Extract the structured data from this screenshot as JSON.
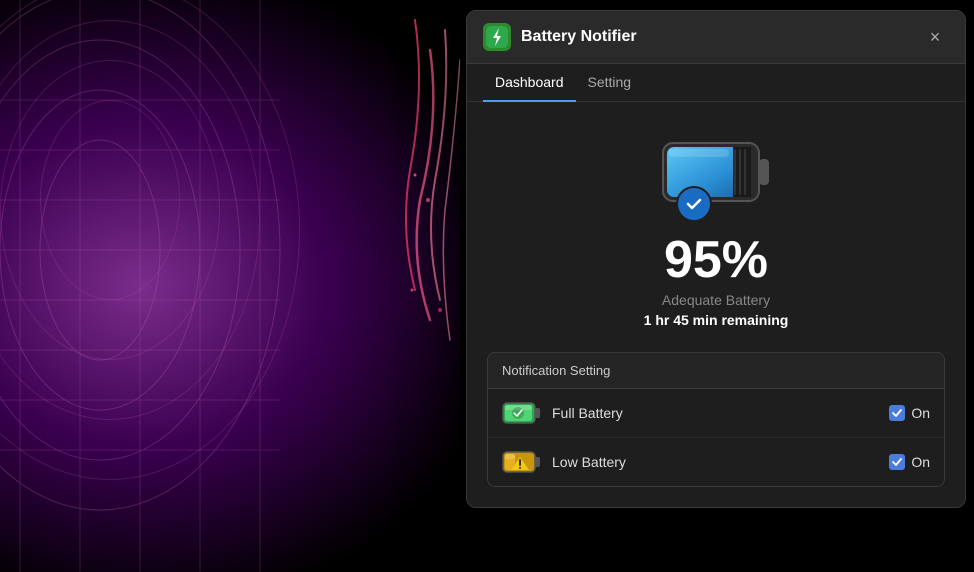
{
  "background": {
    "color": "#000000"
  },
  "app": {
    "title": "Battery Notifier",
    "icon": "battery-icon",
    "close_label": "×"
  },
  "nav": {
    "tabs": [
      {
        "label": "Dashboard",
        "active": true
      },
      {
        "label": "Setting",
        "active": false
      }
    ]
  },
  "dashboard": {
    "battery_percent": "95%",
    "battery_status": "Adequate Battery",
    "battery_time": "1 hr 45 min remaining"
  },
  "notification_setting": {
    "header": "Notification Setting",
    "items": [
      {
        "label": "Full Battery",
        "toggle_label": "On",
        "checked": true,
        "icon": "full-battery"
      },
      {
        "label": "Low Battery",
        "toggle_label": "On",
        "checked": true,
        "icon": "low-battery"
      }
    ]
  }
}
